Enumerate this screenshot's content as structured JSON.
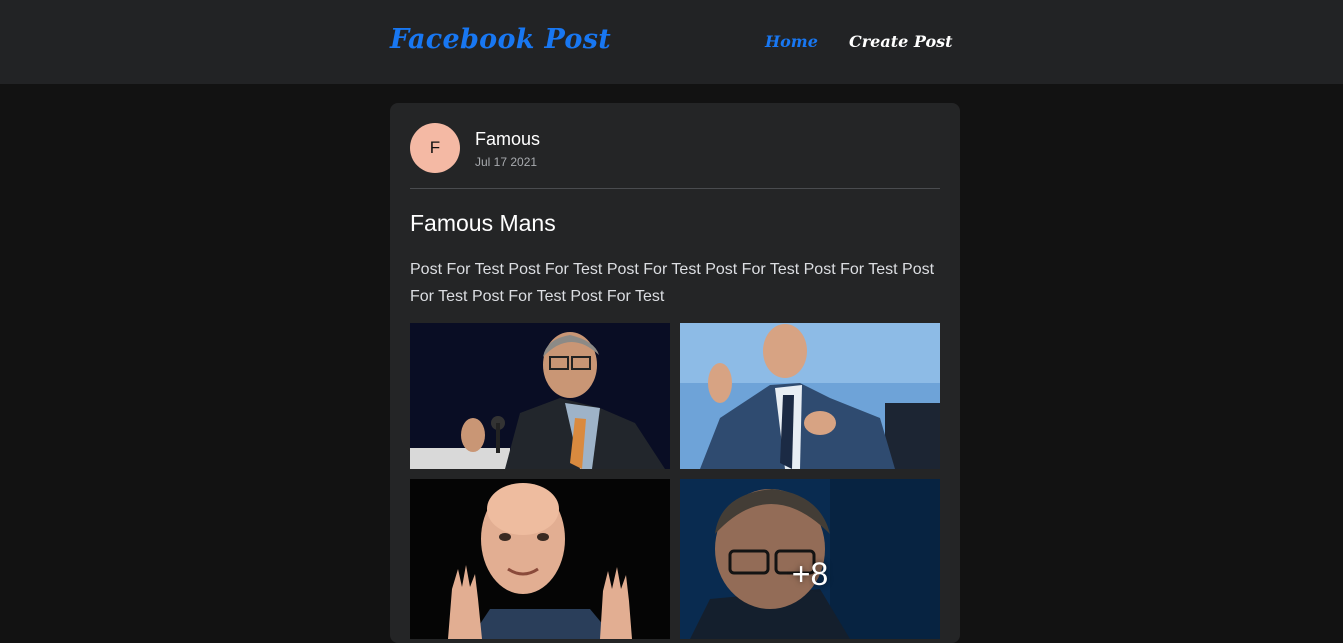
{
  "navbar": {
    "brand": "Facebook Post",
    "links": [
      {
        "label": "Home",
        "active": true
      },
      {
        "label": "Create Post",
        "active": false
      }
    ]
  },
  "post": {
    "avatar_initial": "F",
    "author": "Famous",
    "date": "Jul 17 2021",
    "title": "Famous Mans",
    "body": "Post For Test Post For Test Post For Test Post For Test Post For Test Post For Test Post For Test Post For Test",
    "more_count": "+8"
  },
  "colors": {
    "accent": "#1877f2",
    "page_bg": "#121212",
    "card_bg": "#242526",
    "navbar_bg": "#222325",
    "avatar_bg": "#f4b9a4"
  }
}
